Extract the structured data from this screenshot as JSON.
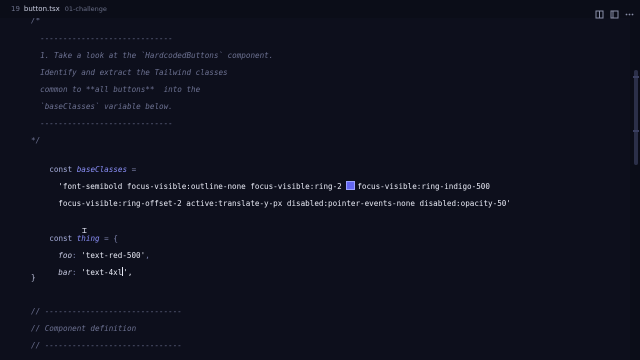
{
  "tab": {
    "number": "19",
    "filename": "button.tsx",
    "path": "01-challenge"
  },
  "icons": [
    "split-view-icon",
    "preview-icon",
    "more-icon"
  ],
  "colors": {
    "background": "#0d0f1c",
    "swatch": "#6366f1"
  },
  "code": {
    "comment_open": "/*",
    "comment_rule": "  -----------------------------",
    "comment_line1": "  1. Take a look at the `HardcodedButtons` component.",
    "comment_line2": "  Identify and extract the Tailwind classes",
    "comment_line3": "  common to **all buttons**  into the",
    "comment_line4": "  `baseClasses` variable below.",
    "comment_rule2": "  -----------------------------",
    "comment_close": "*/",
    "const_kw": "const",
    "base_var": "baseClasses",
    "equals": "=",
    "base_str_part1": "'font-semibold focus-visible:outline-none focus-visible:ring-2 ",
    "base_str_part2": "focus-visible:ring-indigo-500",
    "base_str_line2": "focus-visible:ring-offset-2 active:translate-y-px disabled:pointer-events-none disabled:opacity-50'",
    "const_kw2": "const",
    "thing_var": "thing",
    "equals_brace": "= {",
    "foo_key": "foo",
    "foo_val": "'text-red-500'",
    "bar_key": "bar",
    "bar_val_start": "'text-4xl",
    "bar_val_end": "',",
    "close_brace": "}",
    "rule_comment": "// ------------------------------",
    "section_comment": "// Component definition",
    "rule_comment2": "// ------------------------------"
  }
}
